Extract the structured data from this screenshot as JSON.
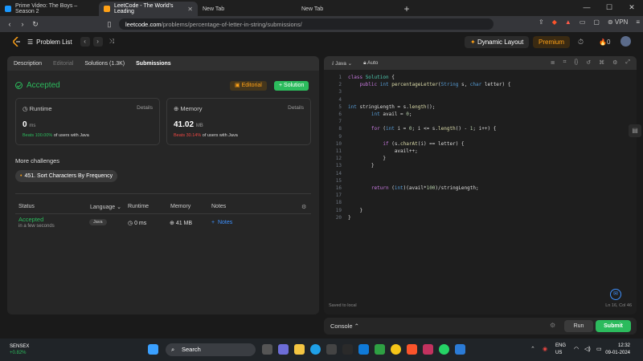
{
  "browser": {
    "tabs": [
      {
        "title": "Prime Video: The Boys – Season 2",
        "color": "#1a98ff"
      },
      {
        "title": "LeetCode - The World's Leading",
        "color": "#ffa116"
      },
      {
        "title": "New Tab",
        "color": ""
      },
      {
        "title": "New Tab",
        "color": ""
      }
    ],
    "url_domain": "leetcode.com",
    "url_path": "/problems/percentage-of-letter-in-string/submissions/",
    "vpn_label": "VPN"
  },
  "lc_nav": {
    "problem_list": "Problem List",
    "dynamic_layout": "Dynamic Layout",
    "premium": "Premium",
    "streak": "0"
  },
  "left": {
    "tabs": [
      "Description",
      "Editorial",
      "Solutions (1.3K)",
      "Submissions"
    ],
    "status": "Accepted",
    "editorial_btn": "Editorial",
    "solution_btn": "Solution",
    "runtime": {
      "label": "Runtime",
      "details": "Details",
      "value": "0",
      "unit": "ms",
      "beats": "Beats 100.00%",
      "beats_suffix": "of users with Java"
    },
    "memory": {
      "label": "Memory",
      "details": "Details",
      "value": "41.02",
      "unit": "MB",
      "beats": "Beats 30.14%",
      "beats_suffix": "of users with Java"
    },
    "more_challenges": "More challenges",
    "challenge": "451. Sort Characters By Frequency",
    "table": {
      "headers": [
        "Status",
        "Language",
        "Runtime",
        "Memory",
        "Notes"
      ],
      "row": {
        "status": "Accepted",
        "time": "in a few seconds",
        "language": "Java",
        "runtime": "0 ms",
        "memory": "41 MB",
        "notes": "Notes"
      }
    }
  },
  "editor": {
    "language": "Java",
    "mode": "Auto",
    "lines": [
      "class Solution {",
      "    public int percentageLetter(String s, char letter) {",
      "",
      "",
      "int stringLength = s.length();",
      "        int avail = 0;",
      "",
      "        for (int i = 0; i <= s.length() - 1; i++) {",
      "",
      "            if (s.charAt(i) == letter) {",
      "                avail++;",
      "            }",
      "        }",
      "",
      "",
      "        return (int)(avail*100)/stringLength;",
      "",
      "",
      "    }",
      "}"
    ],
    "saved": "Saved to local",
    "cursor": "Ln 16, Col 46"
  },
  "console": {
    "label": "Console",
    "run": "Run",
    "submit": "Submit"
  },
  "taskbar": {
    "ticker": "SENSEX",
    "change": "+0.82%",
    "search": "Search",
    "lang1": "ENG",
    "lang2": "US",
    "time": "12:32",
    "date": "09-01-2024"
  }
}
